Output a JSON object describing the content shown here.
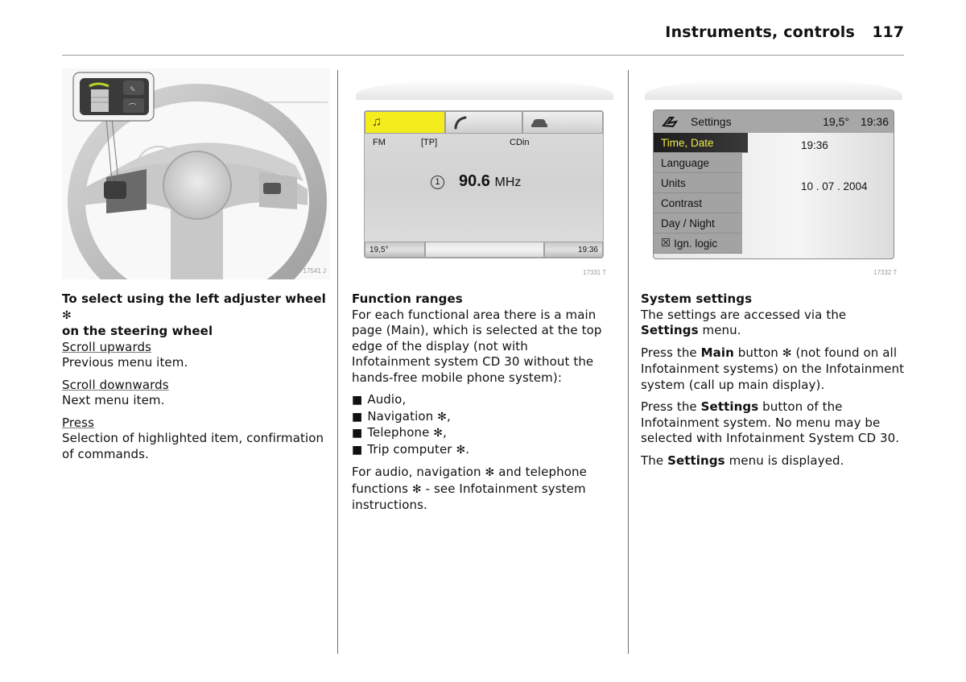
{
  "header": {
    "title": "Instruments, controls",
    "page_number": "117"
  },
  "figures": {
    "steering_wheel": {
      "code": "17541 J",
      "description": "steering-wheel-with-left-adjuster-wheel"
    },
    "audio_display": {
      "code": "17331 T",
      "tabs": [
        {
          "icon": "music-note-icon",
          "active": true,
          "color": "#f4ec1c"
        },
        {
          "icon": "phone-handset-icon",
          "active": false
        },
        {
          "icon": "car-icon",
          "active": false
        }
      ],
      "status": {
        "band": "FM",
        "tp": "[TP]",
        "cd": "CDin"
      },
      "preset": "1",
      "frequency": "90.6",
      "unit": "MHz",
      "temperature": "19,5°",
      "time": "19:36"
    },
    "settings_display": {
      "code": "17332 T",
      "title": "Settings",
      "temperature": "19,5°",
      "time": "19:36",
      "menu": [
        {
          "label": "Time, Date",
          "active": true
        },
        {
          "label": "Language",
          "active": false
        },
        {
          "label": "Units",
          "active": false
        },
        {
          "label": "Contrast",
          "active": false
        },
        {
          "label": "Day / Night",
          "active": false
        },
        {
          "label": "Ign. logic",
          "active": false,
          "checkbox": "checked"
        }
      ],
      "values": {
        "time": "19:36",
        "date": "10 . 07 . 2004"
      },
      "highlight_color": "#ede94a"
    }
  },
  "col1": {
    "heading": "To select using the left adjuster wheel",
    "heading_star": "✻",
    "heading_line2": "on the steering wheel",
    "items": [
      {
        "term": "Scroll upwards",
        "desc": "Previous menu item."
      },
      {
        "term": "Scroll downwards",
        "desc": "Next menu item."
      },
      {
        "term": "Press",
        "desc": "Selection of highlighted item, confirmation of commands."
      }
    ]
  },
  "col2": {
    "heading": "Function ranges",
    "intro": "For each functional area there is a main page (Main), which is selected at the top edge of the display (not with Infotainment system CD 30 without the hands-free mobile phone system):",
    "bullets": [
      {
        "text": "Audio,",
        "star": ""
      },
      {
        "text": "Navigation",
        "star": "✻",
        "suffix": ","
      },
      {
        "text": "Telephone",
        "star": "✻",
        "suffix": ","
      },
      {
        "text": "Trip computer",
        "star": "✻",
        "suffix": "."
      }
    ],
    "outro_a": "For audio, navigation",
    "outro_b": "and telephone functions",
    "outro_c": "- see Infotainment system instructions.",
    "star": "✻"
  },
  "col3": {
    "heading": "System settings",
    "p1_a": "The settings are accessed via the",
    "p1_bold": "Settings",
    "p1_b": "menu.",
    "p2_a": "Press the",
    "p2_bold": "Main",
    "p2_b": "button",
    "p2_star": "✻",
    "p2_c": "(not found on all Infotainment systems) on the Infotainment system (call up main display).",
    "p3_a": "Press the",
    "p3_bold": "Settings",
    "p3_b": "button of the Infotainment system. No menu may be selected with Infotainment System CD 30.",
    "p4_a": "The",
    "p4_bold": "Settings",
    "p4_b": "menu is displayed."
  }
}
